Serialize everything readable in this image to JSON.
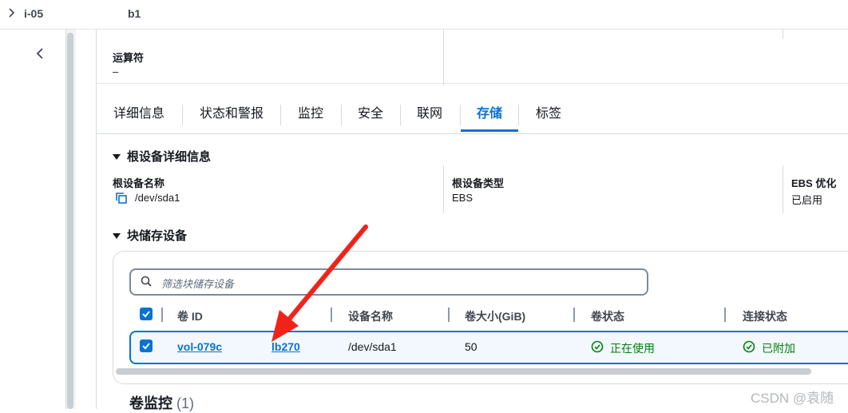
{
  "breadcrumb": {
    "instance_prefix": "i-05",
    "instance_suffix": "b1"
  },
  "operator": {
    "label": "运算符",
    "value": "–"
  },
  "tabs": [
    {
      "label": "详细信息"
    },
    {
      "label": "状态和警报"
    },
    {
      "label": "监控"
    },
    {
      "label": "安全"
    },
    {
      "label": "联网"
    },
    {
      "label": "存储"
    },
    {
      "label": "标签"
    }
  ],
  "active_tab": "存储",
  "root_device": {
    "heading": "根设备详细信息",
    "name_label": "根设备名称",
    "name_value": "/dev/sda1",
    "type_label": "根设备类型",
    "type_value": "EBS",
    "ebs_label": "EBS 优化",
    "ebs_value": "已启用"
  },
  "block_devices": {
    "heading": "块储存设备",
    "search_placeholder": "筛选块储存设备",
    "columns": [
      "卷 ID",
      "设备名称",
      "卷大小(GiB)",
      "卷状态",
      "连接状态"
    ],
    "rows": [
      {
        "volume_id_start": "vol-079c",
        "volume_id_end": "lb270",
        "device_name": "/dev/sda1",
        "size": "50",
        "volume_state": "正在使用",
        "attach_state": "已附加"
      }
    ]
  },
  "volume_monitoring": {
    "title": "卷监控",
    "count": "(1)"
  },
  "watermark": "CSDN @袁随",
  "colors": {
    "accent": "#0972d3",
    "success": "#037f0c",
    "annotation_arrow": "#f0231b"
  }
}
